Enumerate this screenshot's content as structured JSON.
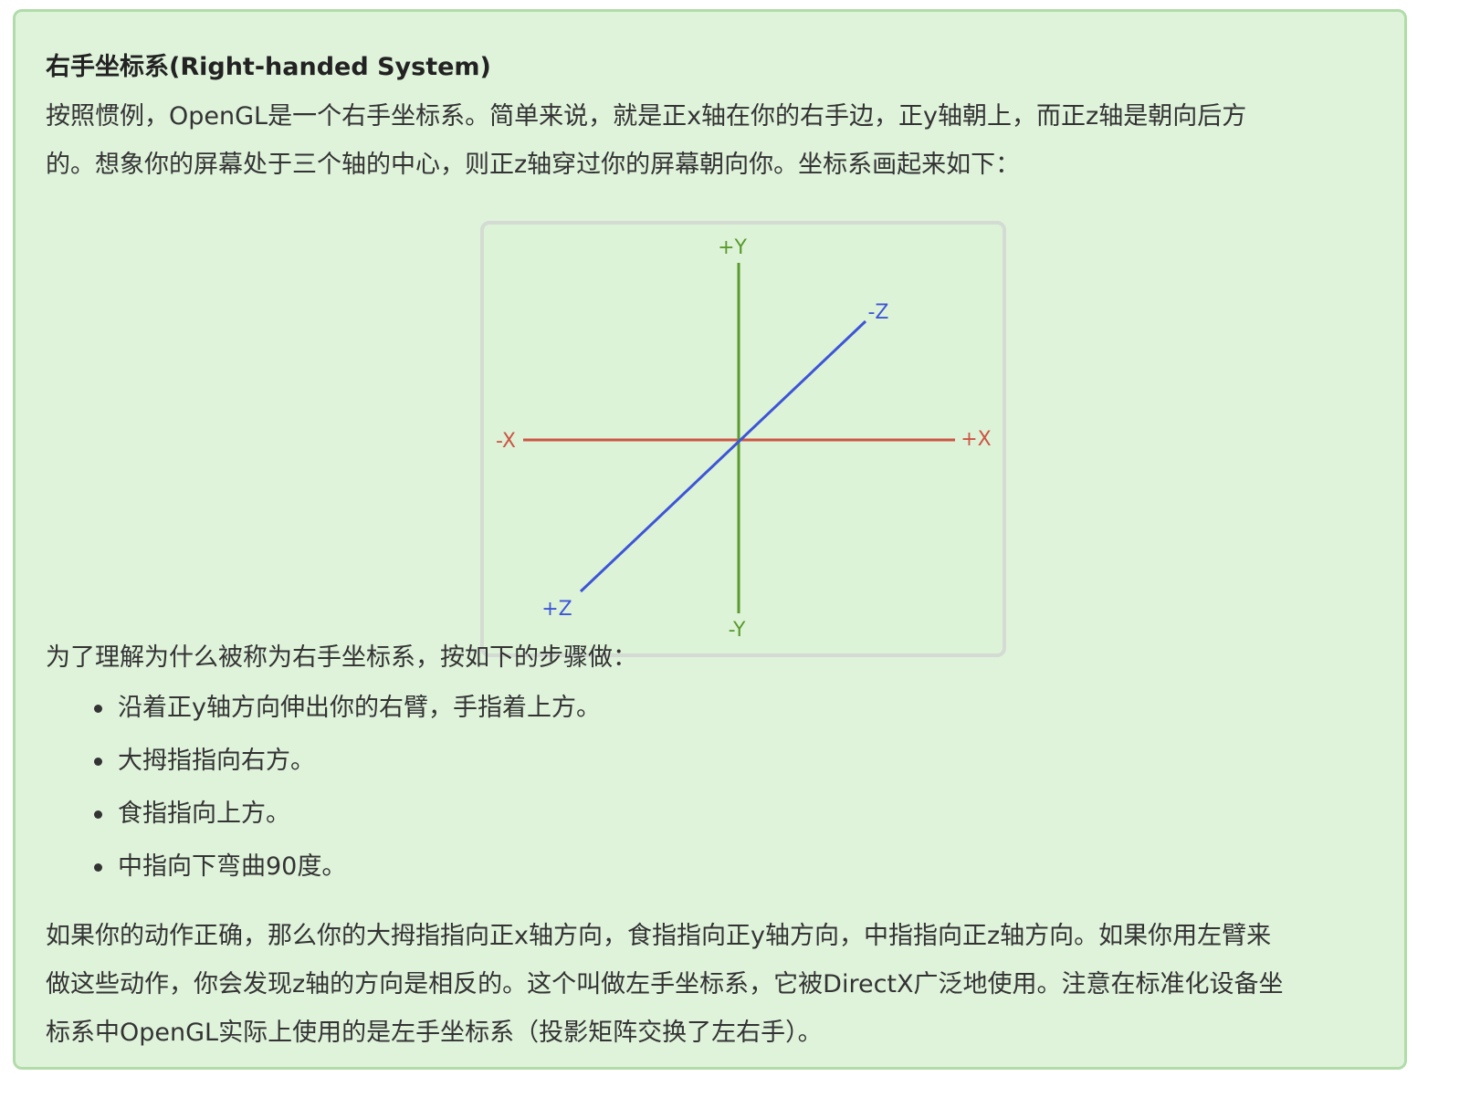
{
  "section": {
    "heading": "右手坐标系(Right-handed System)",
    "intro_lines": [
      "按照惯例，OpenGL是一个右手坐标系。简单来说，就是正x轴在你的右手边，正y轴朝上，而正z轴是朝向后方",
      "的。想象你的屏幕处于三个轴的中心，则正z轴穿过你的屏幕朝向你。坐标系画起来如下："
    ],
    "figure": {
      "labels": {
        "pos_y": "+Y",
        "neg_y": "-Y",
        "pos_x": "+X",
        "neg_x": "-X",
        "pos_z": "+Z",
        "neg_z": "-Z"
      },
      "colors": {
        "x_axis": "#cc5544",
        "y_axis": "#5a9a2e",
        "z_axis": "#3d55d6"
      }
    },
    "steps_intro": "为了理解为什么被称为右手坐标系，按如下的步骤做：",
    "steps": [
      "沿着正y轴方向伸出你的右臂，手指着上方。",
      "大拇指指向右方。",
      "食指指向上方。",
      "中指向下弯曲90度。"
    ],
    "outro_lines": [
      "如果你的动作正确，那么你的大拇指指向正x轴方向，食指指向正y轴方向，中指指向正z轴方向。如果你用左臂来",
      "做这些动作，你会发现z轴的方向是相反的。这个叫做左手坐标系，它被DirectX广泛地使用。注意在标准化设备坐",
      "标系中OpenGL实际上使用的是左手坐标系（投影矩阵交换了左右手）。"
    ]
  },
  "theme": {
    "box_background": "#dff3db",
    "box_border": "#b1dcaa"
  }
}
